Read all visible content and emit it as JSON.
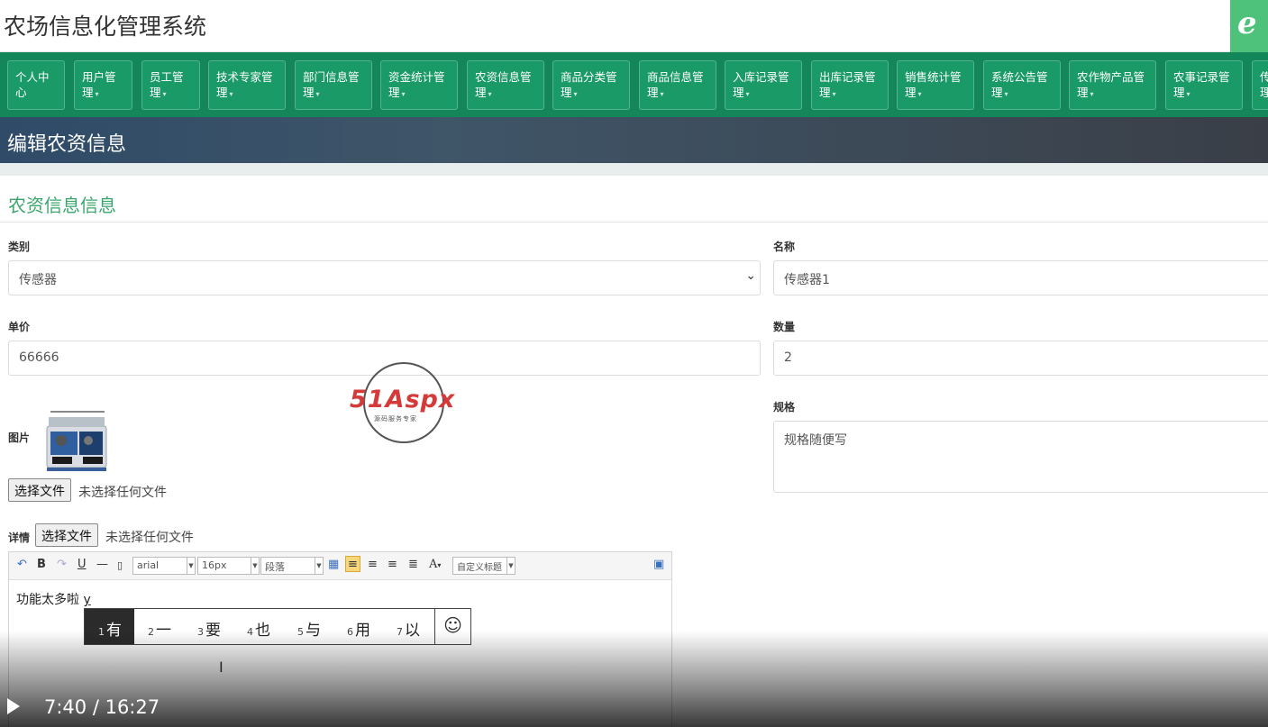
{
  "header": {
    "title": "农场信息化管理系统",
    "browser_badge": "e"
  },
  "nav": {
    "items": [
      {
        "line1": "个人中",
        "line2": "心",
        "caret": false
      },
      {
        "line1": "用户管",
        "line2": "理",
        "caret": true
      },
      {
        "line1": "员工管",
        "line2": "理",
        "caret": true
      },
      {
        "line1": "技术专家管",
        "line2": "理",
        "caret": true
      },
      {
        "line1": "部门信息管",
        "line2": "理",
        "caret": true
      },
      {
        "line1": "资金统计管",
        "line2": "理",
        "caret": true
      },
      {
        "line1": "农资信息管",
        "line2": "理",
        "caret": true
      },
      {
        "line1": "商品分类管",
        "line2": "理",
        "caret": true
      },
      {
        "line1": "商品信息管",
        "line2": "理",
        "caret": true
      },
      {
        "line1": "入库记录管",
        "line2": "理",
        "caret": true
      },
      {
        "line1": "出库记录管",
        "line2": "理",
        "caret": true
      },
      {
        "line1": "销售统计管",
        "line2": "理",
        "caret": true
      },
      {
        "line1": "系统公告管",
        "line2": "理",
        "caret": true
      },
      {
        "line1": "农作物产品管",
        "line2": "理",
        "caret": true
      },
      {
        "line1": "农事记录管",
        "line2": "理",
        "caret": true
      },
      {
        "line1": "传",
        "line2": "理",
        "caret": false
      }
    ]
  },
  "page": {
    "heading": "编辑农资信息",
    "section_title": "农资信息信息"
  },
  "form": {
    "category": {
      "label": "类别",
      "value": "传感器"
    },
    "name": {
      "label": "名称",
      "value": "传感器1"
    },
    "price": {
      "label": "单价",
      "value": "66666"
    },
    "quantity": {
      "label": "数量",
      "value": "2"
    },
    "image": {
      "label": "图片",
      "button": "选择文件",
      "status": "未选择任何文件"
    },
    "spec": {
      "label": "规格",
      "value": "规格随便写"
    },
    "detail": {
      "label": "详情",
      "button": "选择文件",
      "status": "未选择任何文件"
    }
  },
  "editor": {
    "font": "arial",
    "size": "16px",
    "paragraph": "段落",
    "custom_title": "自定义标题",
    "text": "功能太多啦 ",
    "composing": "y"
  },
  "ime": {
    "candidates": [
      {
        "num": "1",
        "char": "有"
      },
      {
        "num": "2",
        "char": "一"
      },
      {
        "num": "3",
        "char": "要"
      },
      {
        "num": "4",
        "char": "也"
      },
      {
        "num": "5",
        "char": "与"
      },
      {
        "num": "6",
        "char": "用"
      },
      {
        "num": "7",
        "char": "以"
      }
    ],
    "emoji": "☺"
  },
  "watermark": {
    "brand": "51Aspx",
    "tagline": "源码服务专家"
  },
  "video": {
    "timecode": "7:40 / 16:27"
  },
  "colors": {
    "nav_bg": "#14875a",
    "section_title": "#3aa66c",
    "header_bg": "#2f4b68"
  }
}
